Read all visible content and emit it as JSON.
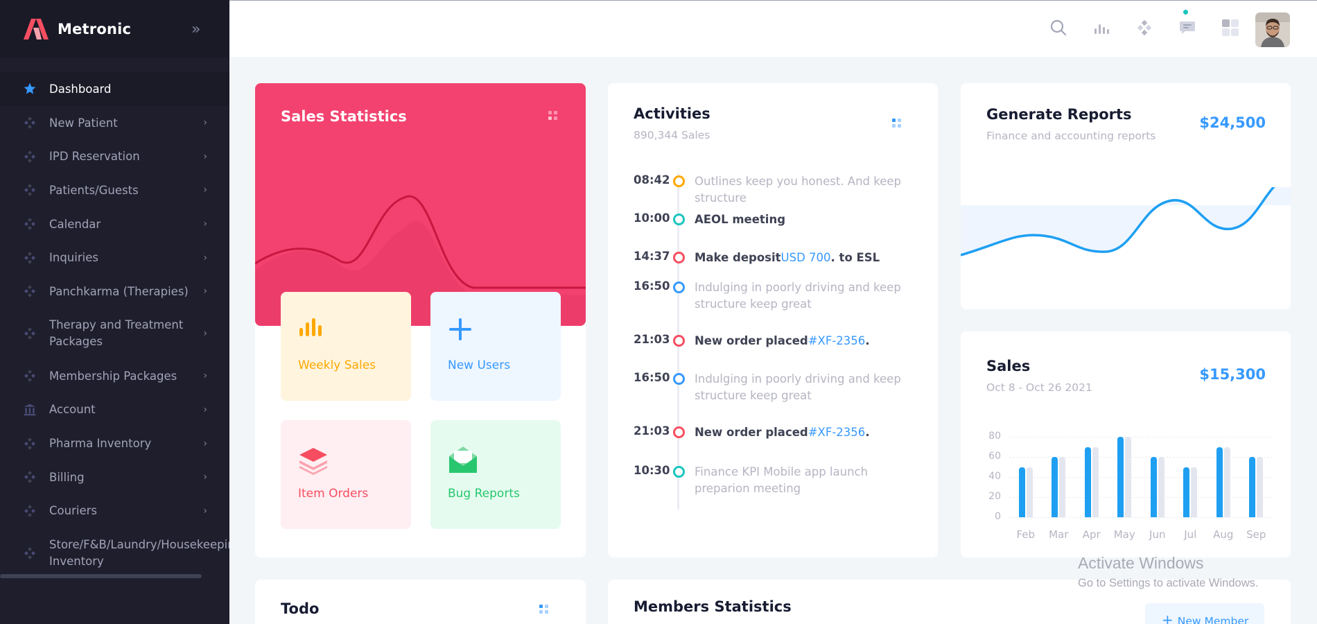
{
  "brand": {
    "name": "Metronic"
  },
  "sidebar": {
    "items": [
      {
        "label": "Dashboard",
        "icon": "star-icon",
        "active": true
      },
      {
        "label": "New Patient",
        "icon": "diamond-dots-icon"
      },
      {
        "label": "IPD Reservation",
        "icon": "diamond-dots-icon"
      },
      {
        "label": "Patients/Guests",
        "icon": "diamond-dots-icon"
      },
      {
        "label": "Calendar",
        "icon": "diamond-dots-icon"
      },
      {
        "label": "Inquiries",
        "icon": "diamond-dots-icon"
      },
      {
        "label": "Panchkarma (Therapies)",
        "icon": "diamond-dots-icon"
      },
      {
        "label": "Therapy and Treatment Packages",
        "icon": "diamond-dots-icon"
      },
      {
        "label": "Membership Packages",
        "icon": "diamond-dots-icon"
      },
      {
        "label": "Account",
        "icon": "bank-icon"
      },
      {
        "label": "Pharma Inventory",
        "icon": "diamond-dots-icon"
      },
      {
        "label": "Billing",
        "icon": "diamond-dots-icon"
      },
      {
        "label": "Couriers",
        "icon": "diamond-dots-icon"
      },
      {
        "label": "Store/F&B/Laundry/Housekeeping Inventory",
        "icon": "diamond-dots-icon"
      }
    ]
  },
  "header": {
    "icons": [
      "search-icon",
      "bar-chart-icon",
      "diamond-dots-icon",
      "chat-icon",
      "apps-grid-icon"
    ]
  },
  "sales_statistics": {
    "title": "Sales Statistics",
    "tiles": [
      {
        "label": "Weekly Sales",
        "icon": "bar-chart-icon",
        "color": "#ffa800"
      },
      {
        "label": "New Users",
        "icon": "plus-icon",
        "color": "#3699ff"
      },
      {
        "label": "Item Orders",
        "icon": "layers-icon",
        "color": "#f64e60"
      },
      {
        "label": "Bug Reports",
        "icon": "envelope-icon",
        "color": "#1bc5bd"
      }
    ]
  },
  "activities": {
    "title": "Activities",
    "subtitle": "890,344 Sales",
    "items": [
      {
        "time": "08:42",
        "color": "#ffa800",
        "text": "Outlines keep you honest. And keep structure",
        "bold": false
      },
      {
        "time": "10:00",
        "color": "#1bc5bd",
        "text": "AEOL meeting",
        "bold": true
      },
      {
        "time": "14:37",
        "color": "#f64e60",
        "text": "Make deposit",
        "link": "USD 700",
        "suffix": ". to ESL",
        "bold": true
      },
      {
        "time": "16:50",
        "color": "#3699ff",
        "text": "Indulging in poorly driving and keep structure keep great",
        "bold": false
      },
      {
        "time": "21:03",
        "color": "#f64e60",
        "text": "New order placed",
        "link": "#XF-2356",
        "suffix": ".",
        "bold": true
      },
      {
        "time": "16:50",
        "color": "#3699ff",
        "text": "Indulging in poorly driving and keep structure keep great",
        "bold": false
      },
      {
        "time": "21:03",
        "color": "#f64e60",
        "text": "New order placed",
        "link": "#XF-2356",
        "suffix": ".",
        "bold": true
      },
      {
        "time": "10:30",
        "color": "#1bc5bd",
        "text": "Finance KPI Mobile app launch preparion meeting",
        "bold": false
      }
    ]
  },
  "reports": {
    "title": "Generate Reports",
    "subtitle": "Finance and accounting reports",
    "amount": "$24,500"
  },
  "sales": {
    "title": "Sales",
    "subtitle": "Oct 8 - Oct 26 2021",
    "amount": "$15,300"
  },
  "chart_data": {
    "type": "bar",
    "categories": [
      "Feb",
      "Mar",
      "Apr",
      "May",
      "Jun",
      "Jul",
      "Aug",
      "Sep"
    ],
    "series": [
      {
        "values": [
          50,
          60,
          70,
          80,
          60,
          50,
          70,
          60
        ]
      },
      {
        "values": [
          50,
          60,
          70,
          80,
          60,
          50,
          70,
          60
        ]
      }
    ],
    "yticks": [
      "80",
      "60",
      "40",
      "20",
      "0"
    ],
    "ylim": [
      0,
      80
    ],
    "colors": [
      "#1e9ff2",
      "#e4e6ef"
    ]
  },
  "todo": {
    "title": "Todo"
  },
  "members": {
    "title": "Members Statistics",
    "button": "New Member"
  },
  "watermark": {
    "line1": "Activate Windows",
    "line2": "Go to Settings to activate Windows."
  }
}
